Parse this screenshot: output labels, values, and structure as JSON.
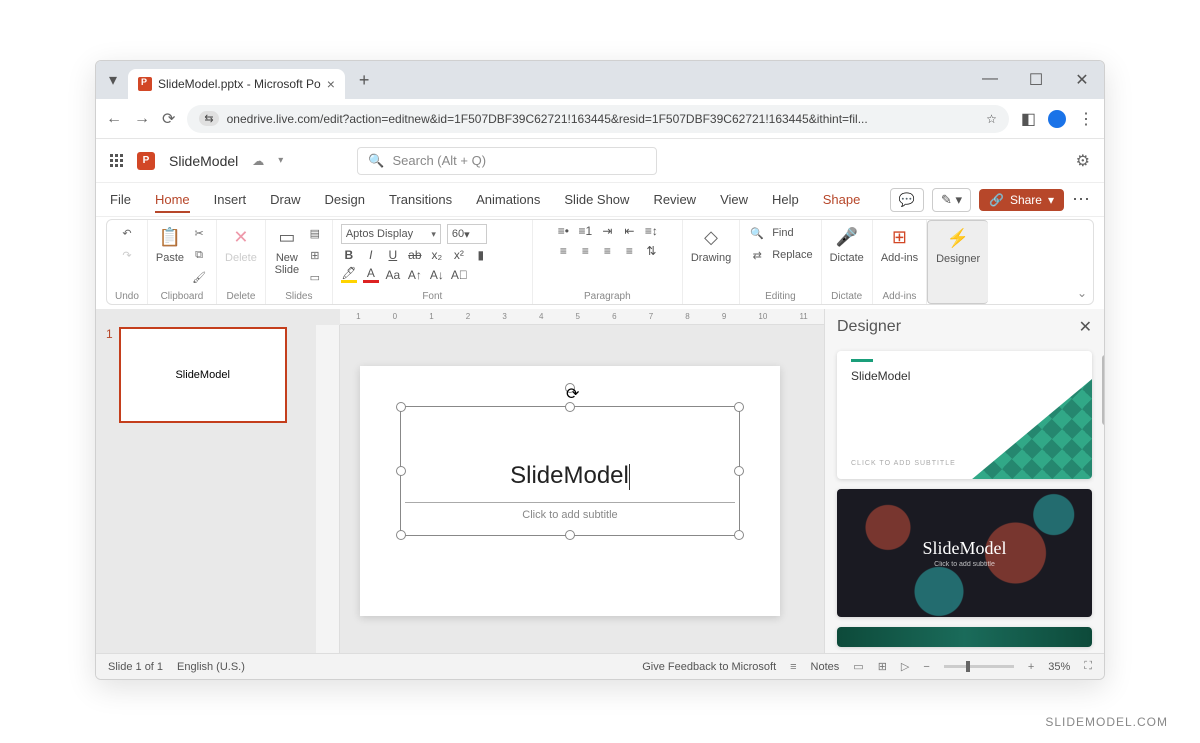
{
  "browser": {
    "tab_title": "SlideModel.pptx - Microsoft Po",
    "url": "onedrive.live.com/edit?action=editnew&id=1F507DBF39C62721!163445&resid=1F507DBF39C62721!163445&ithint=fil..."
  },
  "app": {
    "doc_name": "SlideModel",
    "search_placeholder": "Search (Alt + Q)"
  },
  "tabs": {
    "file": "File",
    "home": "Home",
    "insert": "Insert",
    "draw": "Draw",
    "design": "Design",
    "transitions": "Transitions",
    "animations": "Animations",
    "slideshow": "Slide Show",
    "review": "Review",
    "view": "View",
    "help": "Help",
    "shape": "Shape",
    "share": "Share"
  },
  "ribbon": {
    "undo": "Undo",
    "paste": "Paste",
    "clipboard": "Clipboard",
    "delete": "Delete",
    "new_slide": "New\nSlide",
    "slides": "Slides",
    "font_name": "Aptos Display",
    "font_size": "60",
    "font": "Font",
    "paragraph": "Paragraph",
    "drawing": "Drawing",
    "find": "Find",
    "replace": "Replace",
    "editing": "Editing",
    "dictate": "Dictate",
    "addins": "Add-ins",
    "designer": "Designer"
  },
  "slide": {
    "number": "1",
    "thumb_text": "SlideModel",
    "title": "SlideModel",
    "subtitle_placeholder": "Click to add subtitle"
  },
  "designer": {
    "title": "Designer",
    "card1_title": "SlideModel",
    "card1_sub": "CLICK TO ADD SUBTITLE",
    "card2_title": "SlideModel",
    "card2_sub": "Click to add subtitle"
  },
  "status": {
    "slide_info": "Slide 1 of 1",
    "language": "English (U.S.)",
    "feedback": "Give Feedback to Microsoft",
    "notes": "Notes",
    "zoom": "35%"
  },
  "ruler": [
    "1",
    "0",
    "1",
    "2",
    "3",
    "4",
    "5",
    "6",
    "7",
    "8",
    "9",
    "10",
    "11"
  ],
  "watermark": "SLIDEMODEL.COM"
}
